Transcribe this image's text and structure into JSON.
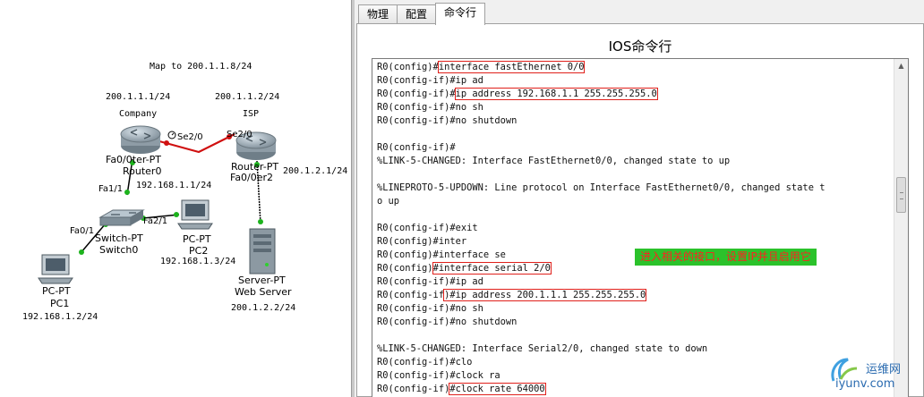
{
  "topology": {
    "map_note": "Map to 200.1.1.8/24",
    "routers": {
      "company": {
        "ip": "200.1.1.1/24",
        "name": "Company",
        "port_label": "Fa0/0ter-PT",
        "device_label": "Router0"
      },
      "isp": {
        "ip": "200.1.1.2/24",
        "name": "ISP",
        "port_label": "Router-PT",
        "device_label": "Fa0/0er2",
        "right_ip": "200.1.2.1/24"
      }
    },
    "links": {
      "serial_left": "Se2/0",
      "serial_right": "Se2/0",
      "fa11": "Fa1/1",
      "fa01": "Fa0/1",
      "fa21": "Fa2/1"
    },
    "router0_lan_ip": "192.168.1.1/24",
    "switch": {
      "type": "Switch-PT",
      "name": "Switch0"
    },
    "pc1": {
      "type": "PC-PT",
      "name": "PC1",
      "ip": "192.168.1.2/24"
    },
    "pc2": {
      "type": "PC-PT",
      "name": "PC2",
      "ip": "192.168.1.3/24"
    },
    "server": {
      "type": "Server-PT",
      "name": "Web Server",
      "ip": "200.1.2.2/24"
    }
  },
  "tabs": [
    "物理",
    "配置",
    "命令行"
  ],
  "active_tab": "命令行",
  "console_title": "IOS命令行",
  "console_lines": [
    {
      "pre": "R0(config)#",
      "cmd": "interface fastEthernet 0/0",
      "highlight": true
    },
    {
      "pre": "R0(config-if)#ip ad",
      "cmd": "",
      "highlight": false
    },
    {
      "pre": "R0(config-if)#",
      "cmd": "ip address 192.168.1.1 255.255.255.0",
      "highlight": true
    },
    {
      "pre": "R0(config-if)#no sh",
      "cmd": "",
      "highlight": false
    },
    {
      "pre": "R0(config-if)#no shutdown",
      "cmd": "",
      "highlight": false
    },
    {
      "pre": "",
      "cmd": "",
      "highlight": false
    },
    {
      "pre": "R0(config-if)#",
      "cmd": "",
      "highlight": false
    },
    {
      "pre": "%LINK-5-CHANGED: Interface FastEthernet0/0, changed state to up",
      "cmd": "",
      "highlight": false
    },
    {
      "pre": "",
      "cmd": "",
      "highlight": false
    },
    {
      "pre": "%LINEPROTO-5-UPDOWN: Line protocol on Interface FastEthernet0/0, changed state t",
      "cmd": "",
      "highlight": false
    },
    {
      "pre": "o up",
      "cmd": "",
      "highlight": false
    },
    {
      "pre": "",
      "cmd": "",
      "highlight": false
    },
    {
      "pre": "R0(config-if)#exit",
      "cmd": "",
      "highlight": false
    },
    {
      "pre": "R0(config)#inter",
      "cmd": "",
      "highlight": false
    },
    {
      "pre": "R0(config)#interface se",
      "cmd": "",
      "highlight": false
    },
    {
      "pre": "R0(config)",
      "cmd": "#interface serial 2/0",
      "highlight": true
    },
    {
      "pre": "R0(config-if)#ip ad",
      "cmd": "",
      "highlight": false
    },
    {
      "pre": "R0(config-if",
      "cmd": ")#ip address 200.1.1.1 255.255.255.0",
      "highlight": true
    },
    {
      "pre": "R0(config-if)#no sh",
      "cmd": "",
      "highlight": false
    },
    {
      "pre": "R0(config-if)#no shutdown",
      "cmd": "",
      "highlight": false
    },
    {
      "pre": "",
      "cmd": "",
      "highlight": false
    },
    {
      "pre": "%LINK-5-CHANGED: Interface Serial2/0, changed state to down",
      "cmd": "",
      "highlight": false
    },
    {
      "pre": "R0(config-if)#clo",
      "cmd": "",
      "highlight": false
    },
    {
      "pre": "R0(config-if)#clock ra",
      "cmd": "",
      "highlight": false
    },
    {
      "pre": "R0(config-if)",
      "cmd": "#clock rate 64000",
      "highlight": true
    }
  ],
  "annotation_note": "进入相关的接口，设置IP并且启用它",
  "watermark": {
    "cn": "运维网",
    "url": "iyunv.com"
  },
  "colors": {
    "highlight_box": "#e0201b",
    "note_bg": "#2bc22b",
    "note_text": "#ff2020",
    "link_green": "#1db31d",
    "link_red": "#d01010"
  }
}
